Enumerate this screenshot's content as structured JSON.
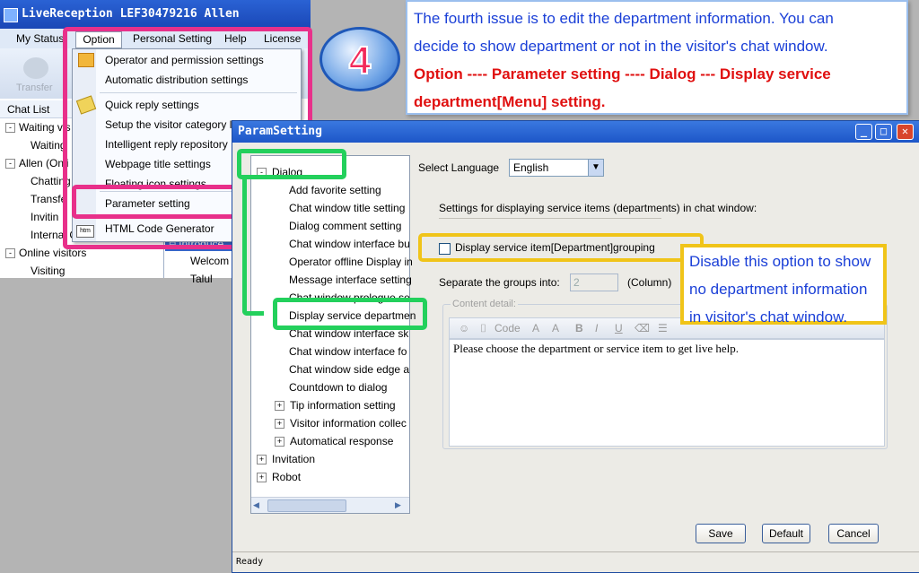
{
  "back_window": {
    "title": "LiveReception  LEF30479216 Allen",
    "menus": [
      "My Status",
      "Option",
      "Personal Setting",
      "Help",
      "License"
    ],
    "toolbar_label": "Transfer",
    "chat_list": [
      {
        "label": "Chat List",
        "level": 0
      },
      {
        "label": "Waiting vis",
        "level": 0,
        "expander": "-"
      },
      {
        "label": "Waiting",
        "level": 1
      },
      {
        "label": "Allen (Onli",
        "level": 0,
        "expander": "-"
      },
      {
        "label": "Chatting",
        "level": 1
      },
      {
        "label": "Transfe",
        "level": 1
      },
      {
        "label": "Invitin",
        "level": 1
      },
      {
        "label": "Internal C",
        "level": 1
      },
      {
        "label": "Online visitors",
        "level": 0,
        "expander": "-"
      },
      {
        "label": "Visiting",
        "level": 1
      }
    ],
    "side_items": [
      "Introduce",
      "Welcom",
      "Talul"
    ]
  },
  "option_menu": {
    "items": [
      {
        "label": "Operator and permission settings",
        "icon": "users-icon"
      },
      {
        "label": "Automatic distribution settings"
      },
      {
        "label": "Quick reply settings",
        "icon": "pencil-icon"
      },
      {
        "label": "Setup the visitor category list"
      },
      {
        "label": "Intelligent reply repository"
      },
      {
        "label": "Webpage title settings"
      },
      {
        "label": "Floating icon settings"
      },
      {
        "label": "Parameter setting"
      },
      {
        "label": "HTML Code Generator",
        "icon": "html-icon"
      }
    ]
  },
  "annotation": {
    "number": "4",
    "line1": "The fourth issue is to edit the department information. You can",
    "line2": "decide to show department or not in the visitor's chat window.",
    "line3": "Option ---- Parameter setting ---- Dialog --- Display service",
    "line4": "department[Menu] setting.",
    "callout_line1": "Disable this option to show",
    "callout_line2": "no department information",
    "callout_line3": "in visitor's chat window."
  },
  "dialog": {
    "title": "ParamSetting",
    "tree": [
      {
        "label": "Dialog",
        "level": 0,
        "expander": "-"
      },
      {
        "label": "Add favorite setting",
        "level": 1
      },
      {
        "label": "Chat window title setting",
        "level": 1
      },
      {
        "label": "Dialog comment setting",
        "level": 1
      },
      {
        "label": "Chat window interface bu",
        "level": 1
      },
      {
        "label": "Operator offline Display in",
        "level": 1
      },
      {
        "label": "Message interface setting",
        "level": 1
      },
      {
        "label": "Chat window prologue se",
        "level": 1
      },
      {
        "label": "Display service departmen",
        "level": 1
      },
      {
        "label": "Chat window interface sk",
        "level": 1
      },
      {
        "label": "Chat window interface fo",
        "level": 1
      },
      {
        "label": "Chat window side edge a",
        "level": 1
      },
      {
        "label": "Countdown to dialog",
        "level": 1
      },
      {
        "label": "Tip information setting",
        "level": 1,
        "expander": "+"
      },
      {
        "label": "Visitor information collec",
        "level": 1,
        "expander": "+"
      },
      {
        "label": "Automatical response",
        "level": 1,
        "expander": "+"
      },
      {
        "label": "Invitation",
        "level": 0,
        "expander": "+"
      },
      {
        "label": "Robot",
        "level": 0,
        "expander": "+"
      }
    ],
    "select_language_label": "Select Language",
    "language_value": "English",
    "section_heading": "Settings for displaying service items (departments) in chat window:",
    "checkbox_label": "Display service item[Department]grouping",
    "checkbox_checked": false,
    "separate_label": "Separate the groups into:",
    "groups_value": "2",
    "column_label": "(Column)",
    "content_detail_label": "Content detail:",
    "editor_code_label": "Code",
    "editor_text": "Please choose the department or service item to get live help.",
    "save_label": "Save",
    "default_label": "Default",
    "cancel_label": "Cancel",
    "status_text": "Ready"
  }
}
